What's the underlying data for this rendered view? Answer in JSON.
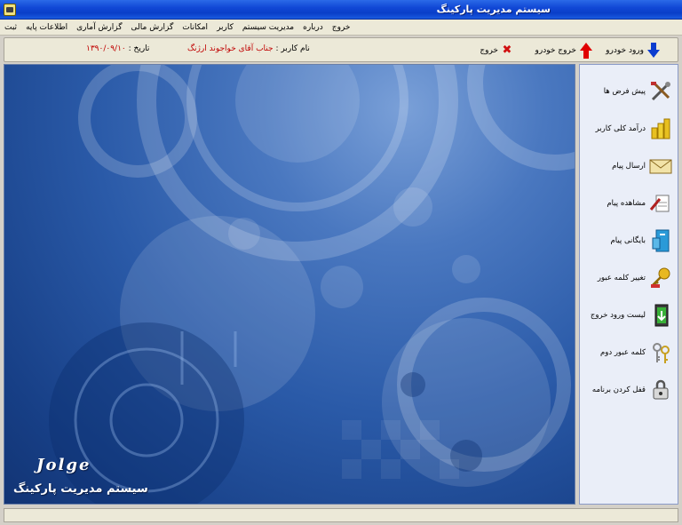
{
  "window": {
    "title": "سیستم مدیریت پارکینگ"
  },
  "menu": [
    "ثبت",
    "اطلاعات پایه",
    "گزارش آماری",
    "گزارش مالی",
    "امکانات",
    "کاربر",
    "مدیریت سیستم",
    "درباره",
    "خروج"
  ],
  "toolbar": {
    "car_entry": "ورود خودرو",
    "car_exit": "خروج خودرو",
    "exit": "خروج"
  },
  "user_info": {
    "user_label": "نام کاربر :",
    "user_value": "جناب آقای  خواجوند ارژنگ",
    "date_label": "تاریخ :",
    "date_value": "۱۳۹۰/۰۹/۱۰"
  },
  "sidebar": {
    "items": [
      {
        "label": "پیش فرض ها",
        "icon": "tools-icon"
      },
      {
        "label": "درآمد کلی کاربر",
        "icon": "coins-icon"
      },
      {
        "label": "ارسال پیام",
        "icon": "envelope-icon"
      },
      {
        "label": "مشاهده پیام",
        "icon": "read-message-icon"
      },
      {
        "label": "بایگانی پیام",
        "icon": "archive-icon"
      },
      {
        "label": "تغییر کلمه عبور",
        "icon": "key-icon"
      },
      {
        "label": "لیست ورود خروج",
        "icon": "door-icon"
      },
      {
        "label": "کلمه عبور دوم",
        "icon": "keys-icon"
      },
      {
        "label": "قفل کردن برنامه",
        "icon": "lock-icon"
      }
    ]
  },
  "branding": {
    "logo": "Jolge",
    "caption": "سیستم مدیریت پارکینگ"
  }
}
